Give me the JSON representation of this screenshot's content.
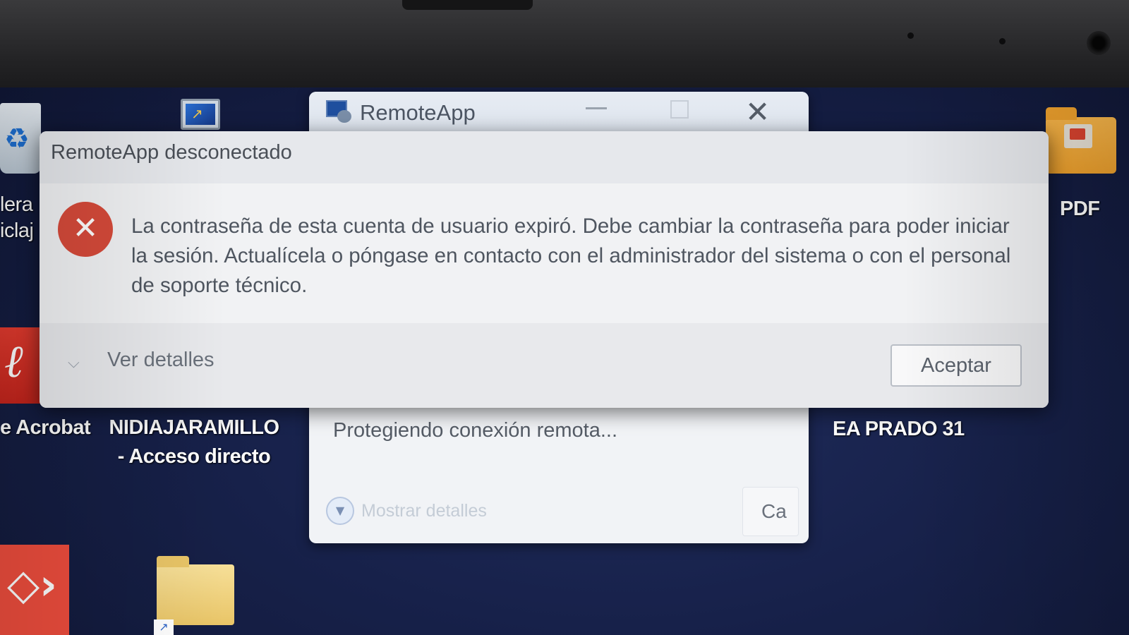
{
  "desktop": {
    "icons": [
      {
        "name": "recycle-bin",
        "label_line1": "lera",
        "label_line2": "iclaj"
      },
      {
        "name": "acrobat",
        "label": "e Acrobat"
      },
      {
        "name": "nidia-shortcut",
        "label_line1": "NIDIAJARAMILLO",
        "label_line2": "- Acceso directo"
      },
      {
        "name": "pdf-folder",
        "label": "PDF"
      },
      {
        "name": "ea-prado",
        "label": "EA PRADO 31"
      }
    ]
  },
  "background_window": {
    "title": "RemoteApp",
    "status": "Protegiendo conexión remota...",
    "details_label": "Mostrar detalles",
    "cancel_label": "Ca"
  },
  "dialog": {
    "title": "RemoteApp desconectado",
    "message": "La contraseña de esta cuenta de usuario expiró. Debe cambiar la contraseña para poder iniciar la sesión. Actualícela o póngase en contacto con el administrador del sistema o con el personal de soporte técnico.",
    "details_label": "Ver detalles",
    "ok_label": "Aceptar"
  },
  "colors": {
    "error_red": "#d64a3a",
    "desktop_blue": "#17214a"
  }
}
